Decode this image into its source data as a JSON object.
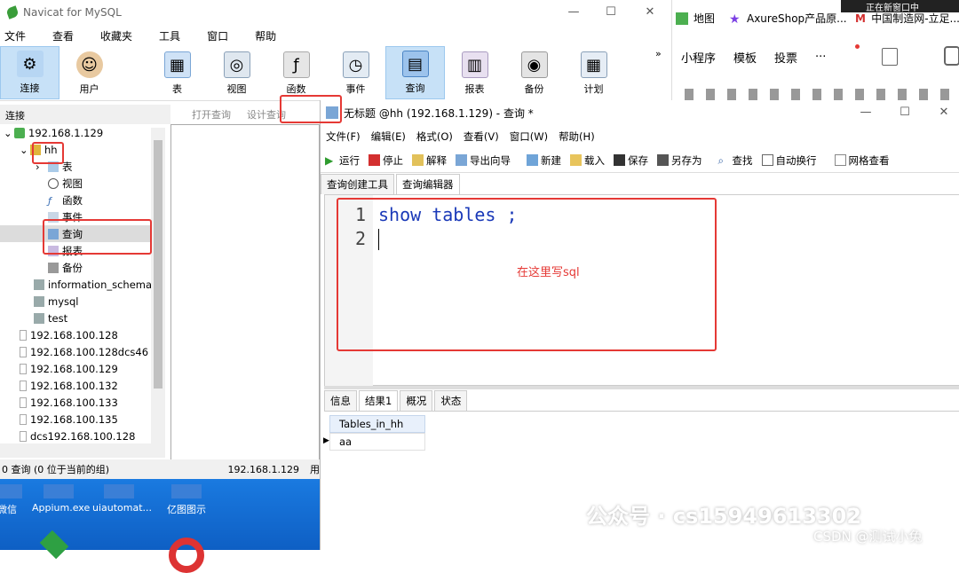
{
  "app": {
    "title": "Navicat for MySQL",
    "menu": [
      "文件",
      "查看",
      "收藏夹",
      "工具",
      "窗口",
      "帮助"
    ],
    "toolbar": [
      "连接",
      "用户",
      "表",
      "视图",
      "函数",
      "事件",
      "查询",
      "报表",
      "备份",
      "计划"
    ],
    "active_tool": "查询"
  },
  "connection": {
    "header": "连接",
    "sub_toolbar": [
      "打开查询",
      "设计查询"
    ],
    "tree": [
      {
        "label": "192.168.1.129",
        "level": 0,
        "expanded": true
      },
      {
        "label": "hh",
        "level": 1,
        "expanded": true
      },
      {
        "label": "表",
        "level": 2
      },
      {
        "label": "视图",
        "level": 2
      },
      {
        "label": "函数",
        "level": 2
      },
      {
        "label": "事件",
        "level": 2
      },
      {
        "label": "查询",
        "level": 2,
        "selected": true
      },
      {
        "label": "报表",
        "level": 2
      },
      {
        "label": "备份",
        "level": 2
      },
      {
        "label": "information_schema",
        "level": 1
      },
      {
        "label": "mysql",
        "level": 1
      },
      {
        "label": "test",
        "level": 1
      },
      {
        "label": "192.168.100.128",
        "level": 0
      },
      {
        "label": "192.168.100.128dcs46",
        "level": 0
      },
      {
        "label": "192.168.100.129",
        "level": 0
      },
      {
        "label": "192.168.100.132",
        "level": 0
      },
      {
        "label": "192.168.100.133",
        "level": 0
      },
      {
        "label": "192.168.100.135",
        "level": 0
      },
      {
        "label": "dcs192.168.100.128",
        "level": 0
      }
    ],
    "status_left": "0 查询 (0 位于当前的组)",
    "status_right": "192.168.1.129",
    "status_right2": "用"
  },
  "desktop": {
    "icons": [
      "微信",
      "Appium.exe",
      "uiautomat...",
      "亿图图示"
    ]
  },
  "query_window": {
    "title": "无标题 @hh (192.168.1.129) - 查询 *",
    "menu": [
      "文件(F)",
      "编辑(E)",
      "格式(O)",
      "查看(V)",
      "窗口(W)",
      "帮助(H)"
    ],
    "toolbar": [
      "运行",
      "停止",
      "解释",
      "导出向导",
      "新建",
      "载入",
      "保存",
      "另存为",
      "查找",
      "自动换行",
      "网格查看"
    ],
    "tabs": [
      "查询创建工具",
      "查询编辑器"
    ],
    "active_tab": "查询编辑器",
    "code_lines": [
      {
        "num": "1",
        "text": "show tables ;"
      },
      {
        "num": "2",
        "text": ""
      }
    ],
    "annotation": "在这里写sql",
    "result_tabs": [
      "信息",
      "结果1",
      "概况",
      "状态"
    ],
    "active_result_tab": "结果1",
    "result_header": "Tables_in_hh",
    "result_rows": [
      "aa"
    ]
  },
  "browser": {
    "bookmarks": [
      "地图",
      "AxureShop产品原...",
      "中国制造网-立足..."
    ],
    "top_text": "正在新窗口中",
    "tabs": [
      "小程序",
      "模板",
      "投票",
      "···"
    ]
  },
  "watermark": {
    "main": "公众号 · cs15949613302",
    "sub": "CSDN @测试小兔"
  }
}
